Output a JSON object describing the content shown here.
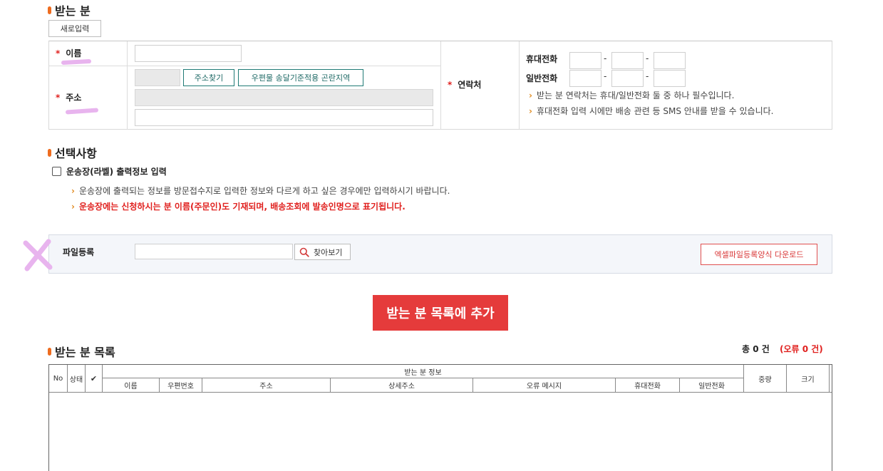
{
  "recipient": {
    "section_title": "받는 분",
    "new_input_label": "새로입력",
    "name_label": "이름",
    "address_label": "주소",
    "find_address_label": "주소찾기",
    "remote_area_label": "우편물 송달기준적용 곤란지역",
    "contact_label": "연락처",
    "mobile_label": "휴대전화",
    "phone_label": "일반전화",
    "dash": "-",
    "required_mark": "*",
    "notes": [
      "받는 분 연락처는 휴대/일반전화 둘 중 하나 필수입니다.",
      "휴대전화 입력 시에만 배송 관련 등 SMS 안내를 받을 수 있습니다."
    ],
    "note_arrow": "›"
  },
  "options": {
    "section_title": "선택사항",
    "checkbox_label": "운송장(라벨) 출력정보 입력",
    "checked": false,
    "note_arrow": "›",
    "note1": "운송장에 출력되는 정보를 방문접수지로 입력한 정보와 다르게 하고 싶은 경우에만 입력하시기 바랍니다.",
    "note2": "운송장에는 신청하시는 분 이름(주문인)도 기재되며, 배송조회에 발송인명으로 표기됩니다."
  },
  "file": {
    "label": "파일등록",
    "browse_label": "찾아보기",
    "download_label": "엑셀파일등록양식 다운로드",
    "accent_color": "#e53b3b"
  },
  "add_button_label": "받는 분 목록에 추가",
  "list": {
    "section_title": "받는 분 목록",
    "total_label": "총 0 건",
    "error_label": "(오류 0 건)",
    "columns": {
      "no": "No",
      "status": "상태",
      "check": "✔",
      "info_group": "받는 분 정보",
      "name": "이름",
      "zip": "우편번호",
      "address": "주소",
      "detail": "상세주소",
      "error": "오류 메시지",
      "mobile": "휴대전화",
      "phone": "일반전화",
      "weight": "중량",
      "size": "크기"
    },
    "rows": []
  },
  "colors": {
    "section_bar": "#ee6c1f",
    "required": "#e0201e",
    "teal": "#1f7a75",
    "highlight": "#e8b4ee"
  }
}
